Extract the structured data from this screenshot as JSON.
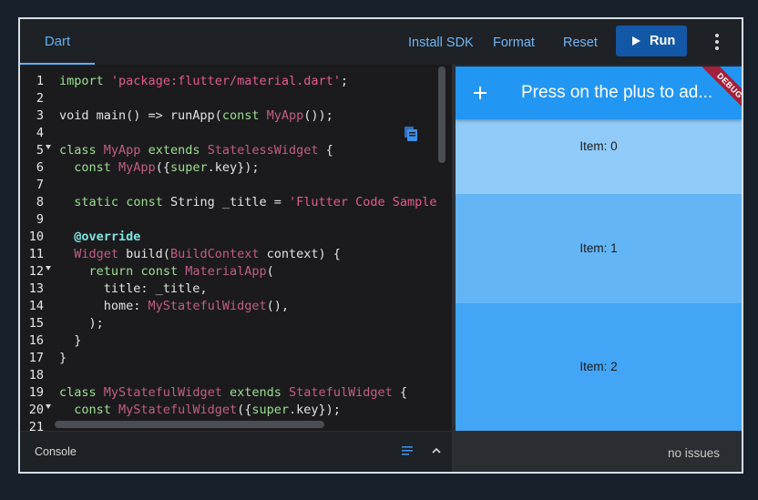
{
  "header": {
    "language_tab": "Dart",
    "install_sdk_label": "Install SDK",
    "format_label": "Format",
    "reset_label": "Reset",
    "run_label": "Run"
  },
  "editor": {
    "line_numbers": [
      "1",
      "2",
      "3",
      "4",
      "5",
      "6",
      "7",
      "8",
      "9",
      "10",
      "11",
      "12",
      "13",
      "14",
      "15",
      "16",
      "17",
      "18",
      "19",
      "20",
      "21"
    ],
    "code_lines": [
      "import 'package:flutter/material.dart';",
      "",
      "void main() => runApp(const MyApp());",
      "",
      "class MyApp extends StatelessWidget {",
      "  const MyApp({super.key});",
      "",
      "  static const String _title = 'Flutter Code Sample",
      "",
      "  @override",
      "  Widget build(BuildContext context) {",
      "    return const MaterialApp(",
      "      title: _title,",
      "      home: MyStatefulWidget(),",
      "    );",
      "  }",
      "}",
      "",
      "class MyStatefulWidget extends StatefulWidget {",
      "  const MyStatefulWidget({super.key});",
      ""
    ]
  },
  "console": {
    "label": "Console"
  },
  "preview": {
    "app_bar_title": "Press on the plus to ad...",
    "debug_banner": "DEBUG",
    "items": [
      {
        "label": "Item: 0",
        "color": "#90caf9"
      },
      {
        "label": "Item: 1",
        "color": "#64b5f6"
      },
      {
        "label": "Item: 2",
        "color": "#42a5f5"
      }
    ]
  },
  "status": {
    "issues_text": "no issues"
  },
  "colors": {
    "accent": "#5eb1f6",
    "run_button": "#1358a6",
    "app_bar": "#2196f3",
    "debug_banner": "#a3213a"
  }
}
